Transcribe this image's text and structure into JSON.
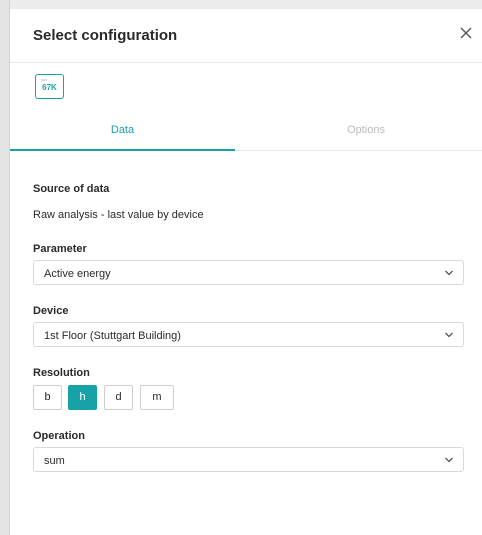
{
  "dialog": {
    "title": "Select configuration"
  },
  "widget_preview": {
    "tiny_text": "kWh",
    "value": "67K"
  },
  "tabs": [
    {
      "label": "Data",
      "active": true
    },
    {
      "label": "Options",
      "active": false
    }
  ],
  "source": {
    "label": "Source of data",
    "value": "Raw analysis - last value by device"
  },
  "parameter": {
    "label": "Parameter",
    "value": "Active energy"
  },
  "device": {
    "label": "Device",
    "value": "1st Floor (Stuttgart Building)"
  },
  "resolution": {
    "label": "Resolution",
    "options": [
      "b",
      "h",
      "d",
      "m"
    ],
    "selected": "h"
  },
  "operation": {
    "label": "Operation",
    "value": "sum"
  },
  "colors": {
    "accent": "#17a2a8",
    "inactive_tab": "#b9b9b9"
  }
}
